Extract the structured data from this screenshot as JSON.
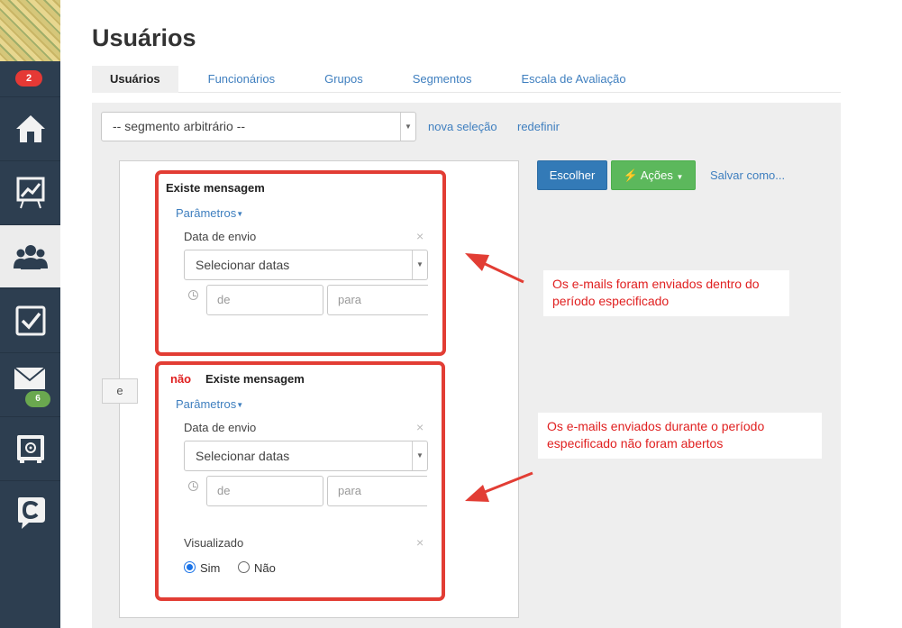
{
  "sidebar": {
    "top_badge": "2",
    "mail_badge": "6",
    "items": [
      {
        "icon": "home-icon"
      },
      {
        "icon": "chart-board-icon"
      },
      {
        "icon": "users-icon"
      },
      {
        "icon": "checkbox-icon"
      },
      {
        "icon": "mail-icon"
      },
      {
        "icon": "safe-icon"
      },
      {
        "icon": "chat-c-icon"
      }
    ]
  },
  "page_title": "Usuários",
  "tabs": [
    "Usuários",
    "Funcionários",
    "Grupos",
    "Segmentos",
    "Escala de Avaliação"
  ],
  "segment": {
    "select_value": "-- segmento arbitrário --",
    "new_selection": "nova seleção",
    "reset": "redefinir"
  },
  "join_operator": "e",
  "condition1": {
    "title": "Existe mensagem",
    "params": "Parâmetros",
    "field_label": "Data de envio",
    "date_select": "Selecionar datas",
    "from_placeholder": "de",
    "to_placeholder": "para"
  },
  "condition2": {
    "negation": "não",
    "title": "Existe mensagem",
    "params": "Parâmetros",
    "field_label": "Data de envio",
    "date_select": "Selecionar datas",
    "from_placeholder": "de",
    "to_placeholder": "para",
    "viewed_label": "Visualizado",
    "yes": "Sim",
    "no": "Não",
    "selected": "Sim"
  },
  "actions": {
    "choose": "Escolher",
    "actions": "Ações",
    "save_as": "Salvar como..."
  },
  "annotations": {
    "note1": "Os e-mails foram enviados dentro do período especificado",
    "note2": "Os e-mails enviados durante o período especificado não foram abertos"
  },
  "colors": {
    "sidebar": "#2d3e50",
    "highlight_red": "#e23d34",
    "link_blue": "#3f7fbf",
    "primary_button": "#337ab7",
    "success_button": "#5cb85c"
  }
}
